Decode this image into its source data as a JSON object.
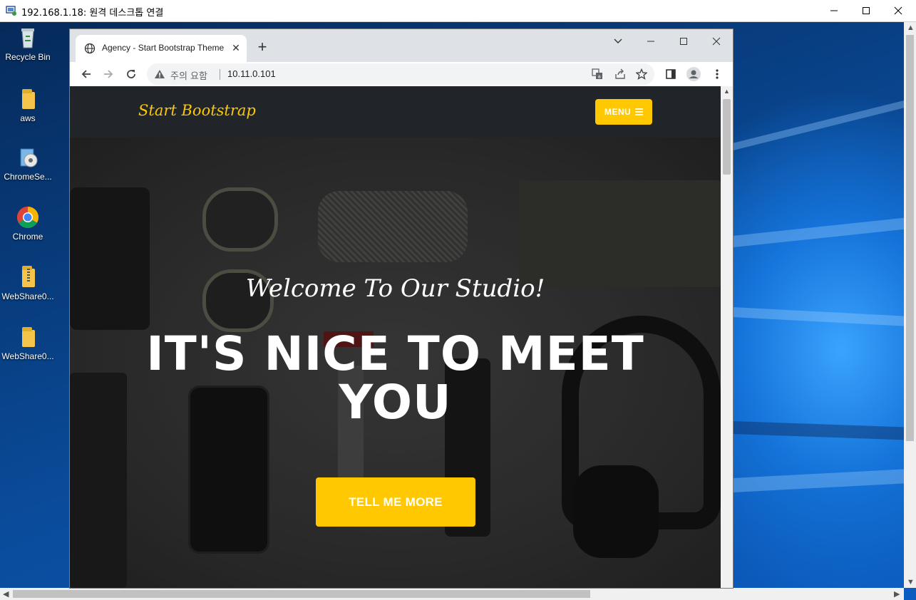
{
  "rdp": {
    "title": "192.168.1.18: 원격 데스크톱 연결"
  },
  "desktop": {
    "icons": [
      {
        "label": "Recycle Bin",
        "icon": "recycle-bin-icon"
      },
      {
        "label": "aws",
        "icon": "folder-icon"
      },
      {
        "label": "ChromeSe...",
        "icon": "installer-icon"
      },
      {
        "label": "Chrome",
        "icon": "chrome-icon"
      },
      {
        "label": "WebShare0...",
        "icon": "zip-folder-icon"
      },
      {
        "label": "WebShare0...",
        "icon": "folder-icon"
      }
    ]
  },
  "browser": {
    "tab_title": "Agency - Start Bootstrap Theme",
    "security_label": "주의 요함",
    "url": "10.11.0.101"
  },
  "page": {
    "brand": "Start Bootstrap",
    "menu_label": "MENU",
    "hero_subheading": "Welcome To Our Studio!",
    "hero_heading": "IT'S NICE TO MEET YOU",
    "cta_label": "TELL ME MORE"
  },
  "colors": {
    "accent": "#ffc800",
    "navbar": "#212529"
  }
}
